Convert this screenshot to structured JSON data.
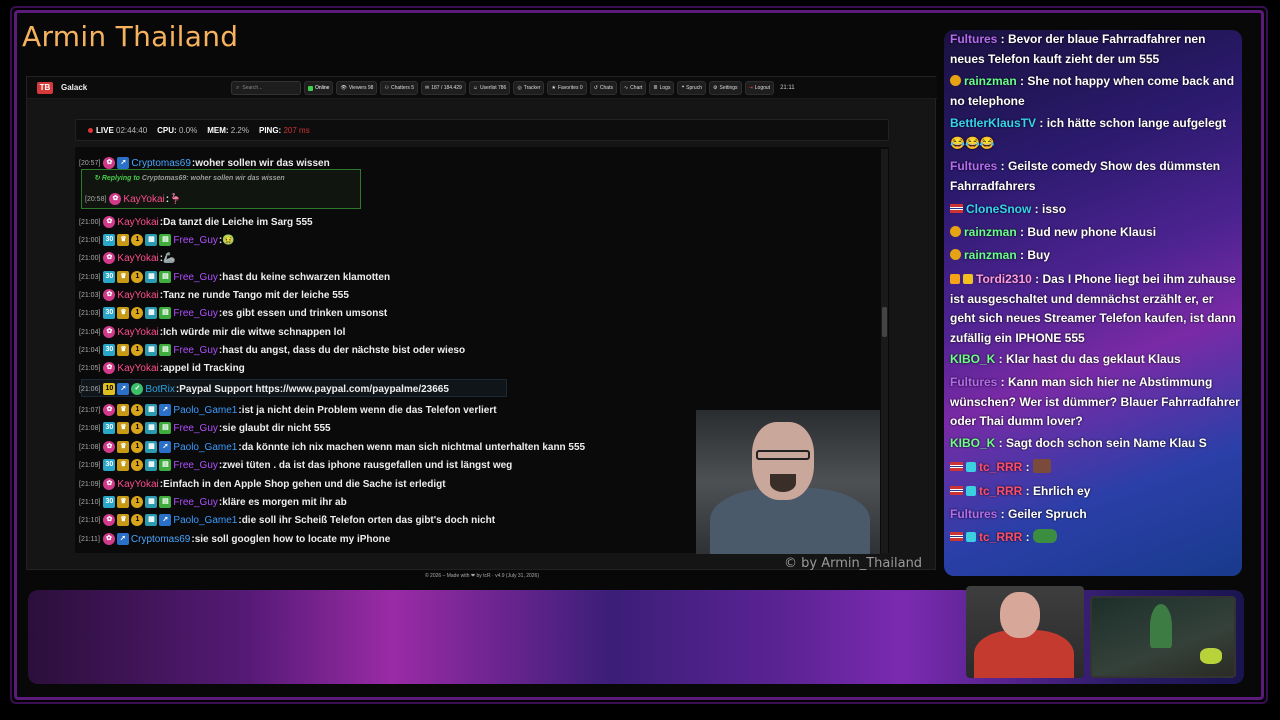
{
  "stream": {
    "title": "Armin Thailand",
    "watermark": "© by Armin_Thailand"
  },
  "app": {
    "logo_icon": "tb-logo-icon",
    "name": "Galack",
    "search_placeholder": "Search...",
    "nav": [
      {
        "label": "Online",
        "icon": "status-square-icon"
      },
      {
        "label": "Viewers 98",
        "icon": "eye-icon"
      },
      {
        "label": "Chatters 5",
        "icon": "users-icon"
      },
      {
        "label": "187 / 184.429",
        "icon": "message-icon"
      },
      {
        "label": "Userlist 786",
        "icon": "user-icon"
      },
      {
        "label": "Tracker",
        "icon": "target-icon"
      },
      {
        "label": "Favorites 0",
        "icon": "star-icon"
      },
      {
        "label": "Chats",
        "icon": "history-icon"
      },
      {
        "label": "Chart",
        "icon": "chart-icon"
      },
      {
        "label": "Logs",
        "icon": "logs-icon"
      },
      {
        "label": "Spruch",
        "icon": "quote-icon"
      },
      {
        "label": "Settings",
        "icon": "gear-icon"
      },
      {
        "label": "Logout",
        "icon": "logout-icon"
      }
    ],
    "clock": "21:11",
    "status": {
      "live_label": "LIVE",
      "live_time": "02:44:40",
      "cpu_label": "CPU:",
      "cpu_value": "0.0%",
      "mem_label": "MEM:",
      "mem_value": "2.2%",
      "ping_label": "PING:",
      "ping_value": "207 ms"
    },
    "reply": {
      "prefix": "Replying to",
      "target": "Cryptomas69:",
      "quote": "woher sollen wir das wissen"
    },
    "messages": [
      {
        "time": "[20:57]",
        "user": "Cryptomas69",
        "color": "crypto",
        "badges": [
          "pink",
          "blue"
        ],
        "text": "woher sollen wir das wissen"
      },
      {
        "time": "[20:58]",
        "user": "KayYokai",
        "color": "kay",
        "badges": [
          "pink"
        ],
        "text": "🦩"
      },
      {
        "time": "[21:00]",
        "user": "KayYokai",
        "color": "kay",
        "badges": [
          "pink"
        ],
        "text": "Da tanzt die Leiche im Sarg 555"
      },
      {
        "time": "[21:00]",
        "user": "Free_Guy",
        "color": "free",
        "badges": [
          "cyan",
          "crown",
          "gold",
          "teal",
          "green"
        ],
        "text": "🤢"
      },
      {
        "time": "[21:00]",
        "user": "KayYokai",
        "color": "kay",
        "badges": [
          "pink"
        ],
        "text": "🦾"
      },
      {
        "time": "[21:03]",
        "user": "Free_Guy",
        "color": "free",
        "badges": [
          "cyan",
          "crown",
          "gold",
          "teal",
          "green"
        ],
        "text": "hast du keine schwarzen klamotten"
      },
      {
        "time": "[21:03]",
        "user": "KayYokai",
        "color": "kay",
        "badges": [
          "pink"
        ],
        "text": "Tanz ne runde Tango mit der leiche 555"
      },
      {
        "time": "[21:03]",
        "user": "Free_Guy",
        "color": "free",
        "badges": [
          "cyan",
          "crown",
          "gold",
          "teal",
          "green"
        ],
        "text": "es gibt essen und trinken umsonst"
      },
      {
        "time": "[21:04]",
        "user": "KayYokai",
        "color": "kay",
        "badges": [
          "pink"
        ],
        "text": "Ich würde mir die witwe schnappen lol"
      },
      {
        "time": "[21:04]",
        "user": "Free_Guy",
        "color": "free",
        "badges": [
          "cyan",
          "crown",
          "gold",
          "teal",
          "green"
        ],
        "text": "hast du angst, dass du der nächste bist oder wieso"
      },
      {
        "time": "[21:05]",
        "user": "KayYokai",
        "color": "kay",
        "badges": [
          "pink"
        ],
        "text": "appel id Tracking"
      },
      {
        "time": "[21:06]",
        "user": "BotRix",
        "color": "bot",
        "badges": [
          "yellow",
          "blue",
          "gear"
        ],
        "text": "Paypal Support https://www.paypal.com/paypalme/23665"
      },
      {
        "time": "[21:07]",
        "user": "Paolo_Game1",
        "color": "paolo",
        "badges": [
          "pink",
          "crown",
          "gold",
          "teal",
          "blue"
        ],
        "text": "ist ja nicht dein Problem wenn die das Telefon verliert"
      },
      {
        "time": "[21:08]",
        "user": "Free_Guy",
        "color": "free",
        "badges": [
          "cyan",
          "crown",
          "gold",
          "teal",
          "green"
        ],
        "text": "sie glaubt dir nicht 555"
      },
      {
        "time": "[21:08]",
        "user": "Paolo_Game1",
        "color": "paolo",
        "badges": [
          "pink",
          "crown",
          "gold",
          "teal",
          "blue"
        ],
        "text": "da könnte ich nix machen wenn man sich nichtmal unterhalten kann 555"
      },
      {
        "time": "[21:09]",
        "user": "Free_Guy",
        "color": "free",
        "badges": [
          "cyan",
          "crown",
          "gold",
          "teal",
          "green"
        ],
        "text": "zwei tüten . da ist das iphone rausgefallen und ist längst weg"
      },
      {
        "time": "[21:09]",
        "user": "KayYokai",
        "color": "kay",
        "badges": [
          "pink"
        ],
        "text": "Einfach in den Apple Shop gehen und die Sache ist erledigt"
      },
      {
        "time": "[21:10]",
        "user": "Free_Guy",
        "color": "free",
        "badges": [
          "cyan",
          "crown",
          "gold",
          "teal",
          "green"
        ],
        "text": "kläre es morgen mit ihr ab"
      },
      {
        "time": "[21:10]",
        "user": "Paolo_Game1",
        "color": "paolo",
        "badges": [
          "pink",
          "crown",
          "gold",
          "teal",
          "blue"
        ],
        "text": "die soll ihr Scheiß Telefon orten das gibt's doch nicht"
      },
      {
        "time": "[21:11]",
        "user": "Cryptomas69",
        "color": "crypto",
        "badges": [
          "pink",
          "blue"
        ],
        "text": "sie soll googlen how to locate my iPhone"
      }
    ],
    "footer": "© 2026 – Made with ❤ by tcR · v4.9 (July 31, 2026)"
  },
  "stream_chat": [
    {
      "user": "Fultures",
      "cls": "fut",
      "icon": "",
      "text": "Bevor der blaue Fahrradfahrer nen neues Telefon kauft zieht der um 555"
    },
    {
      "user": "rainzman",
      "cls": "rain",
      "icon": "coin",
      "text": "She not happy when come back and no telephone"
    },
    {
      "user": "BettlerKlausTV",
      "cls": "bet",
      "icon": "",
      "text": "ich hätte schon lange aufgelegt 😂😂😂"
    },
    {
      "user": "Fultures",
      "cls": "fut",
      "icon": "",
      "text": "Geilste comedy Show des dümmsten Fahrradfahrers"
    },
    {
      "user": "CloneSnow",
      "cls": "clone",
      "icon": "flag",
      "text": "isso"
    },
    {
      "user": "rainzman",
      "cls": "rain",
      "icon": "coin",
      "text": "Bud new phone Klausi"
    },
    {
      "user": "rainzman",
      "cls": "rain",
      "icon": "coin",
      "text": "Buy"
    },
    {
      "user": "Tordi2310",
      "cls": "tordi",
      "icon": "fire",
      "text": "Das I Phone liegt bei ihm zuhause ist ausgeschaltet und demnächst erzählt er, er geht sich neues Streamer Telefon kaufen, ist dann zufällig ein IPHONE 555"
    },
    {
      "user": "KIBO_K",
      "cls": "kibo",
      "icon": "",
      "text": "Klar hast du das geklaut Klaus"
    },
    {
      "user": "Fultures",
      "cls": "fut",
      "icon": "",
      "text": "Kann man sich hier ne Abstimmung wünschen? Wer ist dümmer? Blauer Fahrradfahrer oder Thai dumm lover?"
    },
    {
      "user": "KIBO_K",
      "cls": "kibo",
      "icon": "",
      "text": "Sagt doch schon sein Name Klau S"
    },
    {
      "user": "tc_RRR",
      "cls": "tc",
      "icon": "flagbox",
      "text": ""
    },
    {
      "user": "tc_RRR",
      "cls": "tc",
      "icon": "flagbox",
      "text": "Ehrlich ey"
    },
    {
      "user": "Fultures",
      "cls": "fut",
      "icon": "",
      "text": "Geiler Spruch"
    },
    {
      "user": "tc_RRR",
      "cls": "tc",
      "icon": "flagbox",
      "text": ""
    }
  ]
}
